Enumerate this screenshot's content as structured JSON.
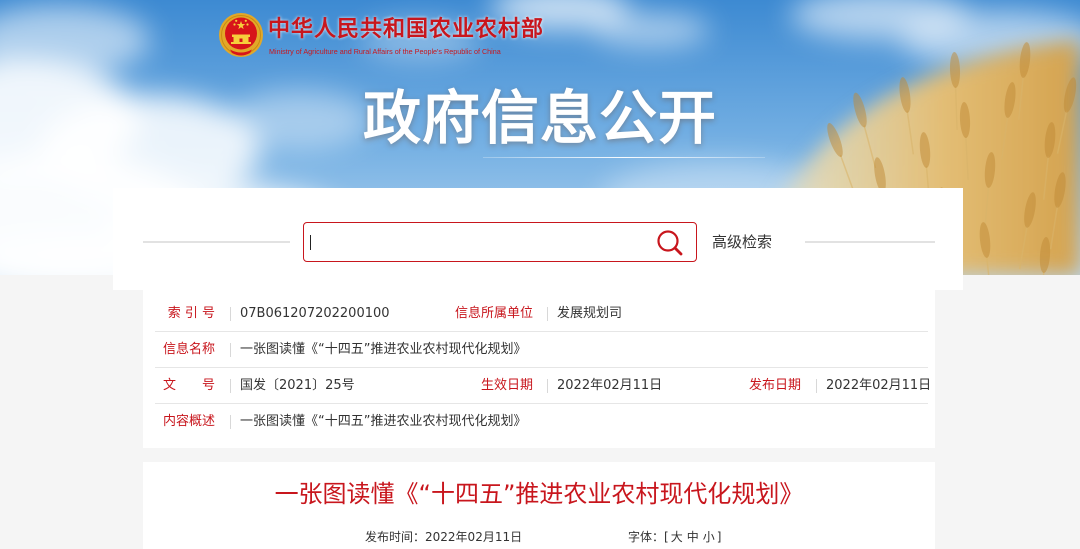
{
  "colors": {
    "brand_red": "#c8161d",
    "text": "#333333",
    "divider": "#e6e6e6",
    "page_background": "#f5f5f5",
    "panel_background": "#ffffff"
  },
  "icons": {
    "emblem": "national-emblem-icon",
    "search": "search-icon"
  },
  "site": {
    "name_cn": "中华人民共和国农业农村部",
    "name_en": "Ministry of Agriculture and Rural Affairs of the People's Republic of China"
  },
  "banner": {
    "title": "政府信息公开"
  },
  "search": {
    "value": "",
    "advanced_label": "高级检索"
  },
  "info_table": {
    "index": {
      "label": "索 引 号",
      "value": "07B061207202200100"
    },
    "unit": {
      "label": "信息所属单位",
      "value": "发展规划司"
    },
    "name": {
      "label": "信息名称",
      "value": "一张图读懂《“十四五”推进农业农村现代化规划》"
    },
    "doc_no": {
      "label": "文　　号",
      "value": "国发〔2021〕25号"
    },
    "effective_date": {
      "label": "生效日期",
      "value": "2022年02月11日"
    },
    "publish_date": {
      "label": "发布日期",
      "value": "2022年02月11日"
    },
    "summary": {
      "label": "内容概述",
      "value": "一张图读懂《“十四五”推进农业农村现代化规划》"
    }
  },
  "article": {
    "title": "一张图读懂《“十四五”推进农业农村现代化规划》",
    "publish_label": "发布时间：",
    "publish_date": "2022年02月11日",
    "font_label": "字体：",
    "font_bracket_open": "[",
    "font_sizes": [
      "大",
      "中",
      "小"
    ],
    "font_bracket_close": "]"
  }
}
